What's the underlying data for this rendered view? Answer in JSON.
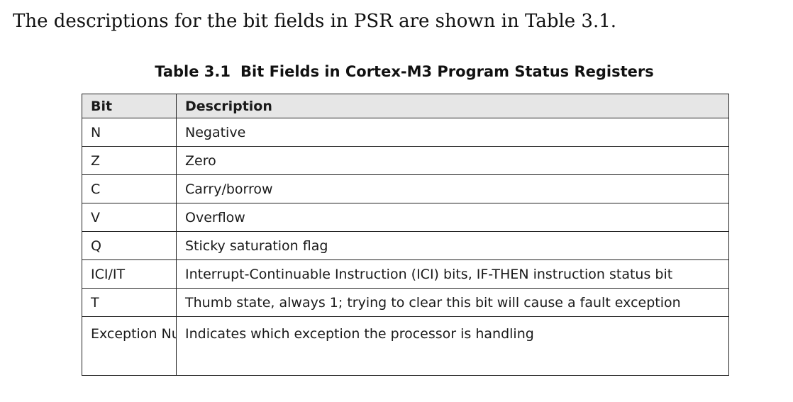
{
  "intro": "The descriptions for the bit fields in PSR are shown in Table 3.1.",
  "caption": {
    "number": "Table 3.1",
    "title": "Bit Fields in Cortex-M3 Program Status Registers"
  },
  "table": {
    "headers": [
      "Bit",
      "Description"
    ],
    "rows": [
      {
        "bit": "N",
        "description": "Negative"
      },
      {
        "bit": "Z",
        "description": "Zero"
      },
      {
        "bit": "C",
        "description": "Carry/borrow"
      },
      {
        "bit": "V",
        "description": "Overflow"
      },
      {
        "bit": "Q",
        "description": "Sticky saturation flag"
      },
      {
        "bit": "ICI/IT",
        "description": "Interrupt-Continuable Instruction (ICI) bits, IF-THEN instruction status bit"
      },
      {
        "bit": "T",
        "description": "Thumb state, always 1; trying to clear this bit will cause a fault exception"
      },
      {
        "bit": "Exception Number",
        "description": "Indicates which exception the processor is handling"
      }
    ]
  }
}
